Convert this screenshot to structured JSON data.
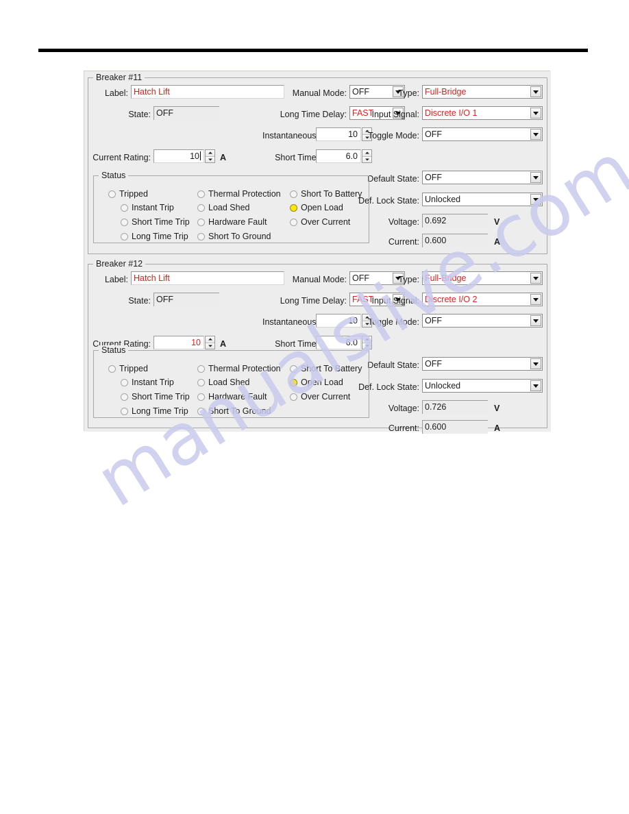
{
  "watermark": {
    "text": "manualslive.com"
  },
  "dialog": {
    "panels": [
      {
        "title": "Breaker #11",
        "fields": {
          "label_label": "Label:",
          "label_value": "Hatch Lift",
          "state_label": "State:",
          "state_value": "OFF",
          "current_rating_label": "Current Rating:",
          "current_rating_value": "10",
          "current_rating_unit": "A",
          "manual_mode_label": "Manual Mode:",
          "manual_mode_value": "OFF",
          "long_time_delay_label": "Long Time Delay:",
          "long_time_delay_value": "FAST",
          "instantaneous_pickup_label": "Instantaneous Pickup:",
          "instantaneous_pickup_value": "10",
          "short_time_pickup_label": "Short Time Pickup:",
          "short_time_pickup_value": "6.0",
          "type_label": "Type:",
          "type_value": "Full-Bridge",
          "input_signal_label": "Input Signal:",
          "input_signal_value": "Discrete I/O 1",
          "toggle_mode_label": "Toggle Mode:",
          "toggle_mode_value": "OFF",
          "default_state_label": "Default State:",
          "default_state_value": "OFF",
          "def_lock_state_label": "Def. Lock State:",
          "def_lock_state_value": "Unlocked",
          "voltage_label": "Voltage:",
          "voltage_value": "0.692",
          "voltage_unit": "V",
          "current_label": "Current:",
          "current_value": "0.600",
          "current_unit": "A"
        },
        "status": {
          "title": "Status",
          "col1": [
            {
              "label": "Tripped",
              "on": false
            },
            {
              "label": "Instant Trip",
              "on": false
            },
            {
              "label": "Short Time Trip",
              "on": false
            },
            {
              "label": "Long Time Trip",
              "on": false
            }
          ],
          "col2": [
            {
              "label": "Thermal Protection",
              "on": false
            },
            {
              "label": "Load Shed",
              "on": false
            },
            {
              "label": "Hardware Fault",
              "on": false
            },
            {
              "label": "Short To Ground",
              "on": false
            }
          ],
          "col3": [
            {
              "label": "Short To Battery",
              "on": false
            },
            {
              "label": "Open Load",
              "on": true
            },
            {
              "label": "Over Current",
              "on": false
            }
          ]
        }
      },
      {
        "title": "Breaker #12",
        "fields": {
          "label_label": "Label:",
          "label_value": "Hatch Lift",
          "state_label": "State:",
          "state_value": "OFF",
          "current_rating_label": "Current Rating:",
          "current_rating_value": "10",
          "current_rating_unit": "A",
          "manual_mode_label": "Manual Mode:",
          "manual_mode_value": "OFF",
          "long_time_delay_label": "Long Time Delay:",
          "long_time_delay_value": "FAST",
          "instantaneous_pickup_label": "Instantaneous Pickup:",
          "instantaneous_pickup_value": "10",
          "short_time_pickup_label": "Short Time Pickup:",
          "short_time_pickup_value": "6.0",
          "type_label": "Type:",
          "type_value": "Full-Bridge",
          "input_signal_label": "Input Signal:",
          "input_signal_value": "Discrete I/O 2",
          "toggle_mode_label": "Toggle Mode:",
          "toggle_mode_value": "OFF",
          "default_state_label": "Default State:",
          "default_state_value": "OFF",
          "def_lock_state_label": "Def. Lock State:",
          "def_lock_state_value": "Unlocked",
          "voltage_label": "Voltage:",
          "voltage_value": "0.726",
          "voltage_unit": "V",
          "current_label": "Current:",
          "current_value": "0.600",
          "current_unit": "A"
        },
        "status": {
          "title": "Status",
          "col1": [
            {
              "label": "Tripped",
              "on": false
            },
            {
              "label": "Instant Trip",
              "on": false
            },
            {
              "label": "Short Time Trip",
              "on": false
            },
            {
              "label": "Long Time Trip",
              "on": false
            }
          ],
          "col2": [
            {
              "label": "Thermal Protection",
              "on": false
            },
            {
              "label": "Load Shed",
              "on": false
            },
            {
              "label": "Hardware Fault",
              "on": false
            },
            {
              "label": "Short To Ground",
              "on": false
            }
          ],
          "col3": [
            {
              "label": "Short To Battery",
              "on": false
            },
            {
              "label": "Open Load",
              "on": true
            },
            {
              "label": "Over Current",
              "on": false
            }
          ]
        }
      }
    ]
  },
  "colors": {
    "value_red": "#e11d1d",
    "indicator_on": "#ffe800",
    "dialog_bg": "#ededed"
  }
}
